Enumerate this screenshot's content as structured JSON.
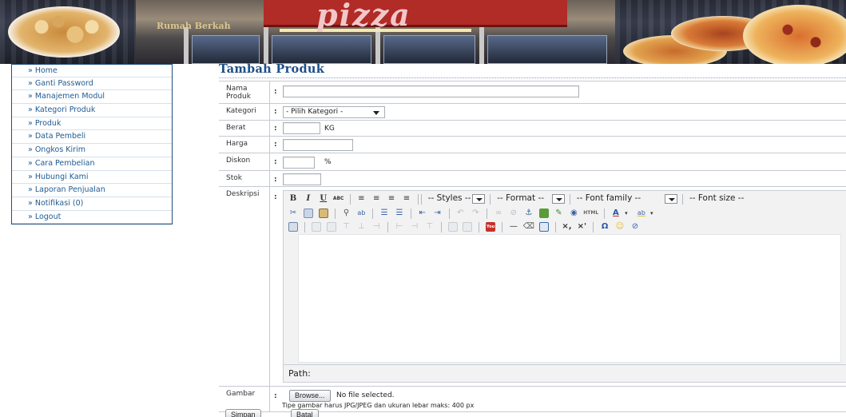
{
  "header": {
    "sign_text": "pizza",
    "brand_text": "Rumah Berkah"
  },
  "sidebar": {
    "items": [
      {
        "label": "» Home"
      },
      {
        "label": "» Ganti Password"
      },
      {
        "label": "» Manajemen Modul"
      },
      {
        "label": "» Kategori Produk"
      },
      {
        "label": "» Produk"
      },
      {
        "label": "» Data Pembeli"
      },
      {
        "label": "» Ongkos Kirim"
      },
      {
        "label": "» Cara Pembelian"
      },
      {
        "label": "» Hubungi Kami"
      },
      {
        "label": "» Laporan Penjualan"
      },
      {
        "label": "» Notifikasi (0)"
      },
      {
        "label": "» Logout"
      }
    ]
  },
  "page": {
    "title": "Tambah Produk"
  },
  "form": {
    "colon": ":",
    "nama_produk": {
      "label": "Nama Produk",
      "value": ""
    },
    "kategori": {
      "label": "Kategori",
      "selected": "- Pilih Kategori -"
    },
    "berat": {
      "label": "Berat",
      "value": "",
      "unit": "KG"
    },
    "harga": {
      "label": "Harga",
      "value": ""
    },
    "diskon": {
      "label": "Diskon",
      "value": "",
      "unit": "%"
    },
    "stok": {
      "label": "Stok",
      "value": ""
    },
    "deskripsi": {
      "label": "Deskripsi"
    },
    "gambar": {
      "label": "Gambar",
      "browse_label": "Browse...",
      "no_file": "No file selected.",
      "hint": "Tipe gambar harus JPG/JPEG dan ukuran lebar maks: 400 px"
    }
  },
  "editor": {
    "styles": "-- Styles --",
    "format": "-- Format --",
    "font_family": "-- Font family --",
    "font_size": "-- Font size --",
    "path_label": "Path:",
    "abc": "ABC",
    "html": "HTML",
    "yt": "You"
  },
  "actions": {
    "save_label": "Simpan",
    "cancel_label": "Batal"
  }
}
